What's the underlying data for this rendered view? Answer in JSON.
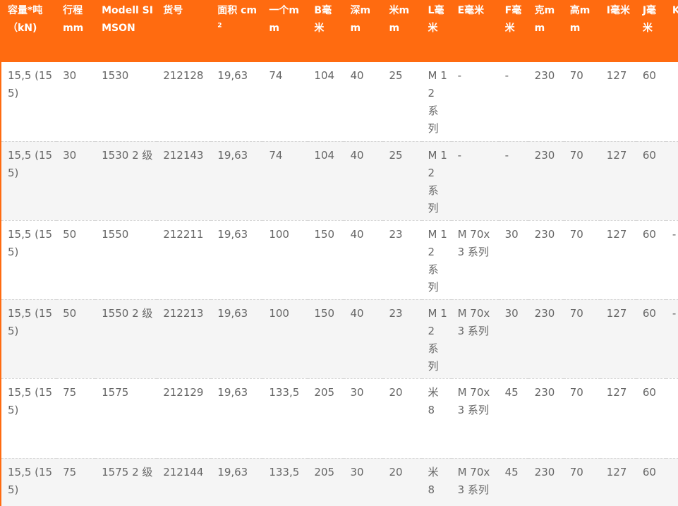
{
  "table": {
    "headers": [
      "容量*吨 （kN)",
      "行程mm",
      "Modell SIMSON",
      "货号",
      "面积 cm",
      "一个mm",
      "B毫米",
      "深mm",
      "米mm",
      "L毫米",
      "E毫米",
      "F毫米",
      "克mm",
      "高mm",
      "I毫米",
      "J毫米",
      "K"
    ],
    "area_unit_superscript": "2",
    "rows": [
      [
        "15,5 (155)",
        "30",
        "1530",
        "212128",
        "19,63",
        "74",
        "104",
        "40",
        "25",
        "M 12 系 列",
        "-",
        "-",
        "230",
        "70",
        "127",
        "60",
        ""
      ],
      [
        "15,5 (155)",
        "30",
        "1530 2 级",
        "212143",
        "19,63",
        "74",
        "104",
        "40",
        "25",
        "M 12 系 列",
        "-",
        "-",
        "230",
        "70",
        "127",
        "60",
        ""
      ],
      [
        "15,5 (155)",
        "50",
        "1550",
        "212211",
        "19,63",
        "100",
        "150",
        "40",
        "23",
        "M 12 系 列",
        "M 70x3 系列",
        "30",
        "230",
        "70",
        "127",
        "60",
        "-"
      ],
      [
        "15,5 (155)",
        "50",
        "1550 2 级",
        "212213",
        "19,63",
        "100",
        "150",
        "40",
        "23",
        "M 12 系 列",
        "M 70x3 系列",
        "30",
        "230",
        "70",
        "127",
        "60",
        "-"
      ],
      [
        "15,5 (155)",
        "75",
        "1575",
        "212129",
        "19,63",
        "133,5",
        "205",
        "30",
        "20",
        "米 8",
        "M 70x3 系列",
        "45",
        "230",
        "70",
        "127",
        "60",
        ""
      ],
      [
        "15,5 (155)",
        "75",
        "1575 2 级",
        "212144",
        "19,63",
        "133,5",
        "205",
        "30",
        "20",
        "米 8",
        "M 70x3 系列",
        "45",
        "230",
        "70",
        "127",
        "60",
        ""
      ]
    ]
  },
  "colors": {
    "header_bg": "#ff6b10",
    "header_text": "#ffffff",
    "cell_text": "#666666",
    "stripe_bg": "#f5f5f5"
  }
}
